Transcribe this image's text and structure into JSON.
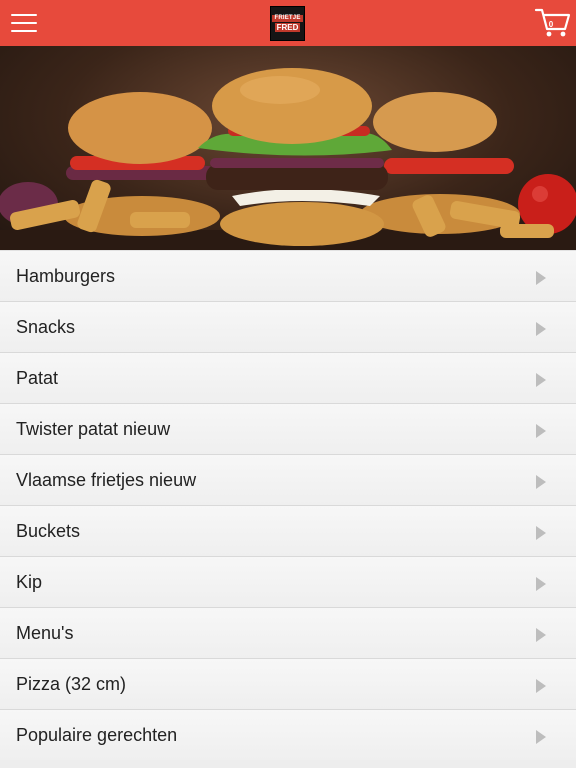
{
  "header": {
    "menu_icon": "hamburger-menu-icon",
    "logo": {
      "line1": "FRIETJE",
      "line2": "FRED"
    },
    "cart_icon": "shopping-cart-icon",
    "cart_count": "0",
    "accent_color": "#e74a3c"
  },
  "hero": {
    "image": "burgers-and-fries-photo"
  },
  "categories": [
    {
      "label": "Hamburgers",
      "icon": "chevron-right-icon"
    },
    {
      "label": "Snacks",
      "icon": "chevron-right-icon"
    },
    {
      "label": "Patat",
      "icon": "chevron-right-icon"
    },
    {
      "label": "Twister patat nieuw",
      "icon": "chevron-right-icon"
    },
    {
      "label": "Vlaamse frietjes nieuw",
      "icon": "chevron-right-icon"
    },
    {
      "label": "Buckets",
      "icon": "chevron-right-icon"
    },
    {
      "label": "Kip",
      "icon": "chevron-right-icon"
    },
    {
      "label": "Menu's",
      "icon": "chevron-right-icon"
    },
    {
      "label": "Pizza (32 cm)",
      "icon": "chevron-right-icon"
    },
    {
      "label": "Populaire gerechten",
      "icon": "chevron-right-icon"
    }
  ]
}
